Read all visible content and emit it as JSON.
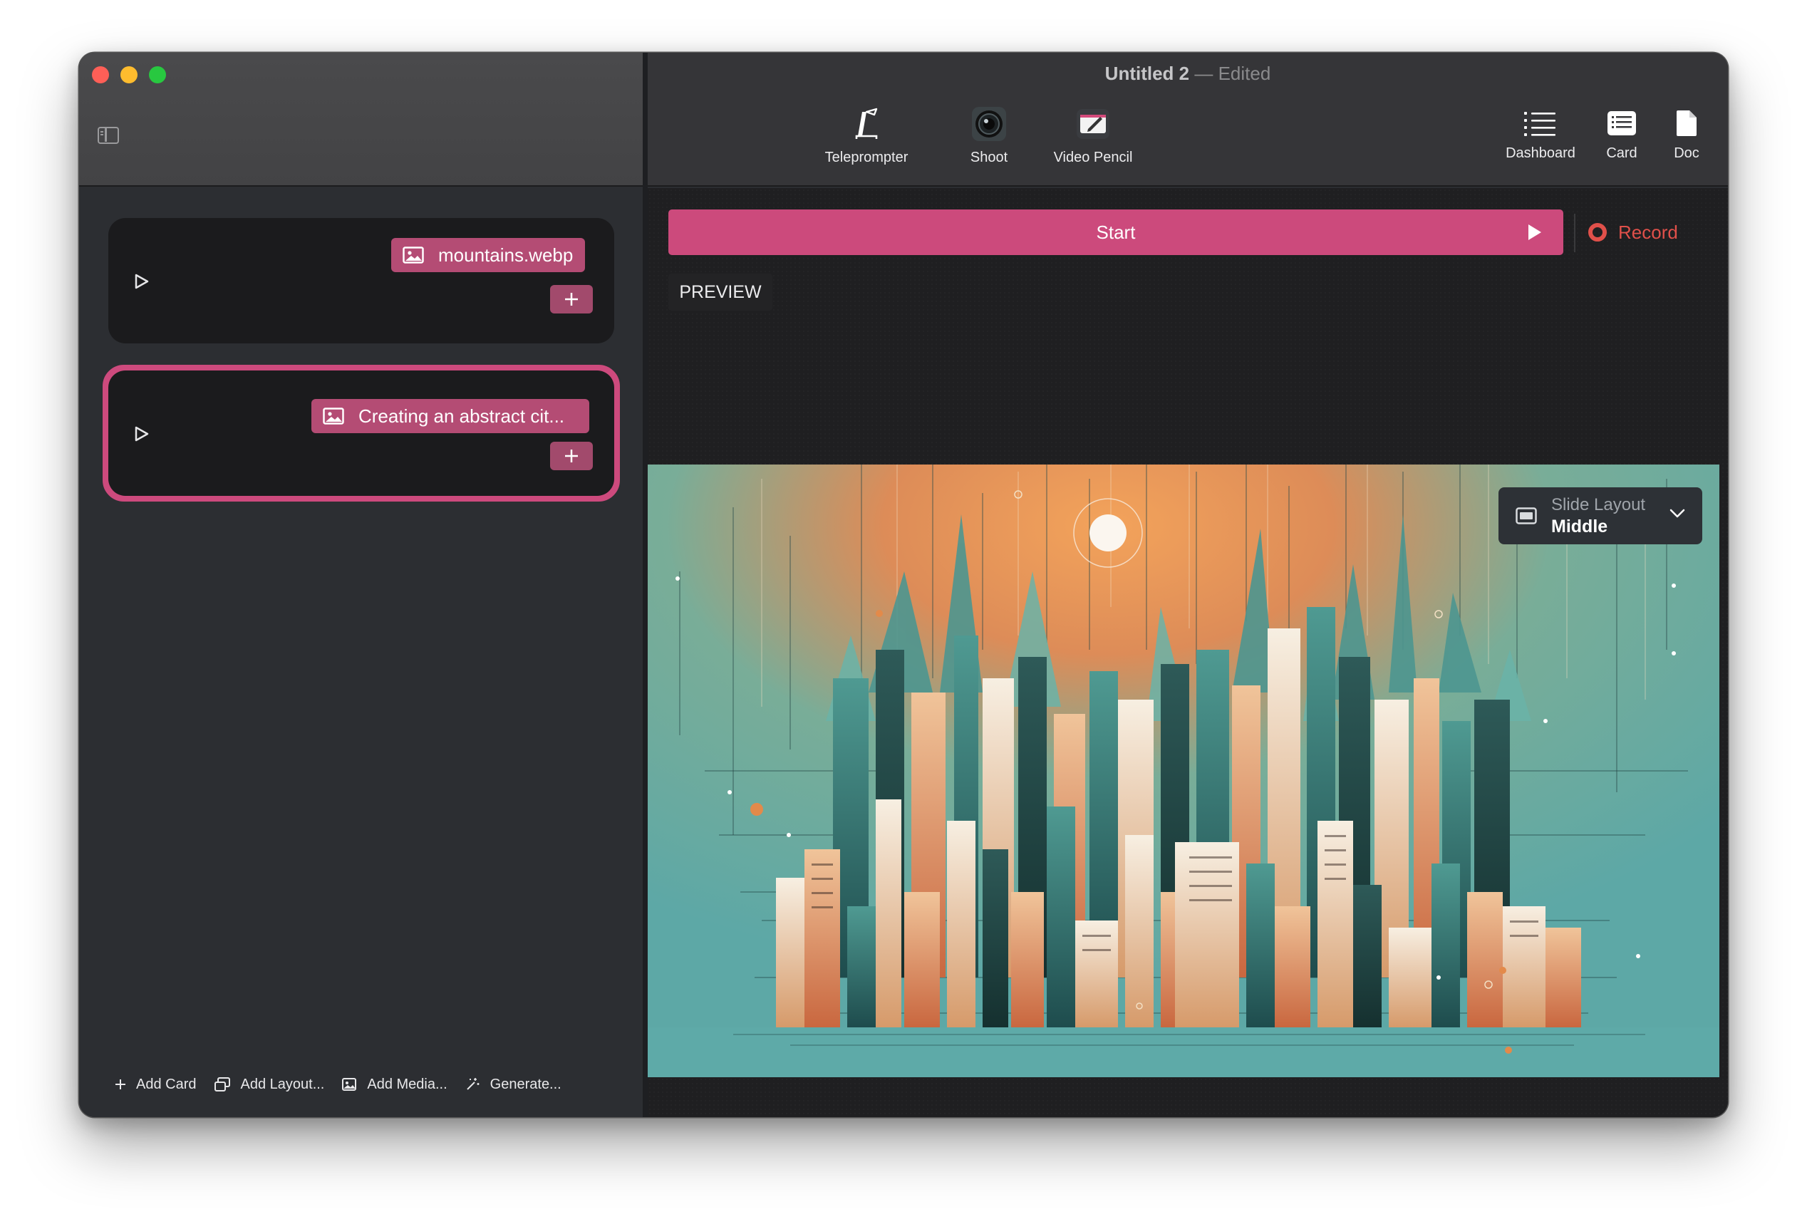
{
  "window": {
    "title": "Untitled 2",
    "title_separator": "—",
    "edited_label": "Edited"
  },
  "toolbar": {
    "center": [
      {
        "label": "Teleprompter",
        "icon": "teleprompter-icon"
      },
      {
        "label": "Shoot",
        "icon": "camera-lens-icon"
      },
      {
        "label": "Video Pencil",
        "icon": "video-pencil-icon"
      }
    ],
    "right": [
      {
        "label": "Dashboard",
        "icon": "list-icon"
      },
      {
        "label": "Card",
        "icon": "card-icon"
      },
      {
        "label": "Doc",
        "icon": "doc-icon"
      }
    ]
  },
  "cards": [
    {
      "media_label": "mountains.webp",
      "media_icon": "image-icon"
    },
    {
      "media_label": "Creating an abstract cit...",
      "media_icon": "image-icon",
      "selected": true
    }
  ],
  "footer": {
    "add_card": "Add Card",
    "add_layout": "Add Layout...",
    "add_media": "Add Media...",
    "generate": "Generate..."
  },
  "main": {
    "start_label": "Start",
    "record_label": "Record",
    "preview_label": "PREVIEW",
    "slide_layout": {
      "label": "Slide Layout",
      "value": "Middle"
    }
  },
  "colors": {
    "accent": "#cc4a7c",
    "record": "#e0504a",
    "chip": "#b44c74"
  }
}
